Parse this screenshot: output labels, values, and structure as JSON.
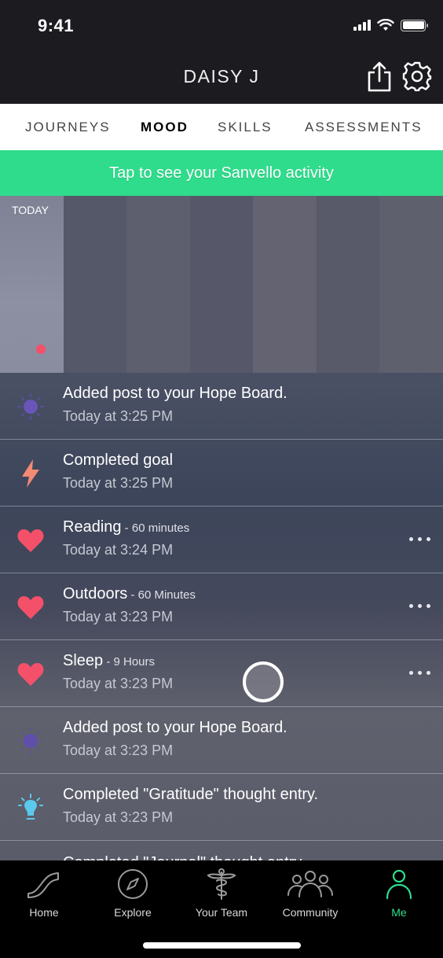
{
  "status_bar": {
    "time": "9:41"
  },
  "header": {
    "title": "DAISY J",
    "share_icon": "share-icon",
    "settings_icon": "gear-icon"
  },
  "tabs": [
    {
      "label": "JOURNEYS",
      "active": false
    },
    {
      "label": "MOOD",
      "active": true
    },
    {
      "label": "SKILLS",
      "active": false
    },
    {
      "label": "ASSESSMENTS",
      "active": false
    }
  ],
  "banner": {
    "text": "Tap to see your Sanvello activity",
    "color": "#2fdc8c"
  },
  "mood_chart": {
    "days": [
      {
        "label": "TODAY",
        "mood_level": 0.1
      },
      {
        "label": "",
        "mood_level": null
      },
      {
        "label": "",
        "mood_level": null
      },
      {
        "label": "",
        "mood_level": null
      },
      {
        "label": "",
        "mood_level": null
      },
      {
        "label": "",
        "mood_level": null
      },
      {
        "label": "",
        "mood_level": null
      }
    ],
    "dot_color": "#f4506a"
  },
  "feed": [
    {
      "icon": "sun-icon",
      "icon_color": "#6a55b8",
      "title": "Added post to your Hope Board.",
      "detail": "",
      "time": "Today at 3:25 PM",
      "has_menu": false
    },
    {
      "icon": "lightning-icon",
      "icon_color": "#f38a73",
      "title": "Completed goal",
      "detail": "",
      "time": "Today at 3:25 PM",
      "has_menu": false
    },
    {
      "icon": "heart-icon",
      "icon_color": "#f4506a",
      "title": "Reading",
      "detail": " - 60 minutes",
      "time": "Today at 3:24 PM",
      "has_menu": true
    },
    {
      "icon": "heart-icon",
      "icon_color": "#f4506a",
      "title": "Outdoors",
      "detail": " - 60 Minutes",
      "time": "Today at 3:23 PM",
      "has_menu": true
    },
    {
      "icon": "heart-icon",
      "icon_color": "#f4506a",
      "title": "Sleep",
      "detail": " - 9 Hours",
      "time": "Today at 3:23 PM",
      "has_menu": true
    },
    {
      "icon": "sun-icon",
      "icon_color": "#6a55b8",
      "title": "Added post to your Hope Board.",
      "detail": "",
      "time": "Today at 3:23 PM",
      "has_menu": false
    },
    {
      "icon": "lightbulb-icon",
      "icon_color": "#5bc8ee",
      "title": "Completed \"Gratitude\" thought entry.",
      "detail": "",
      "time": "Today at 3:23 PM",
      "has_menu": false
    },
    {
      "icon": "journal-icon",
      "icon_color": "#e8485e",
      "title": "Completed \"Journal\" thought entry.",
      "detail": "",
      "time": "",
      "has_menu": false
    }
  ],
  "bottom_nav": [
    {
      "label": "Home",
      "icon": "path-icon",
      "active": false
    },
    {
      "label": "Explore",
      "icon": "compass-icon",
      "active": false
    },
    {
      "label": "Your Team",
      "icon": "caduceus-icon",
      "active": false
    },
    {
      "label": "Community",
      "icon": "people-icon",
      "active": false
    },
    {
      "label": "Me",
      "icon": "person-icon",
      "active": true
    }
  ],
  "colors": {
    "accent": "#2fdc8c",
    "header_bg": "#1b1b20",
    "heart": "#f4506a"
  }
}
